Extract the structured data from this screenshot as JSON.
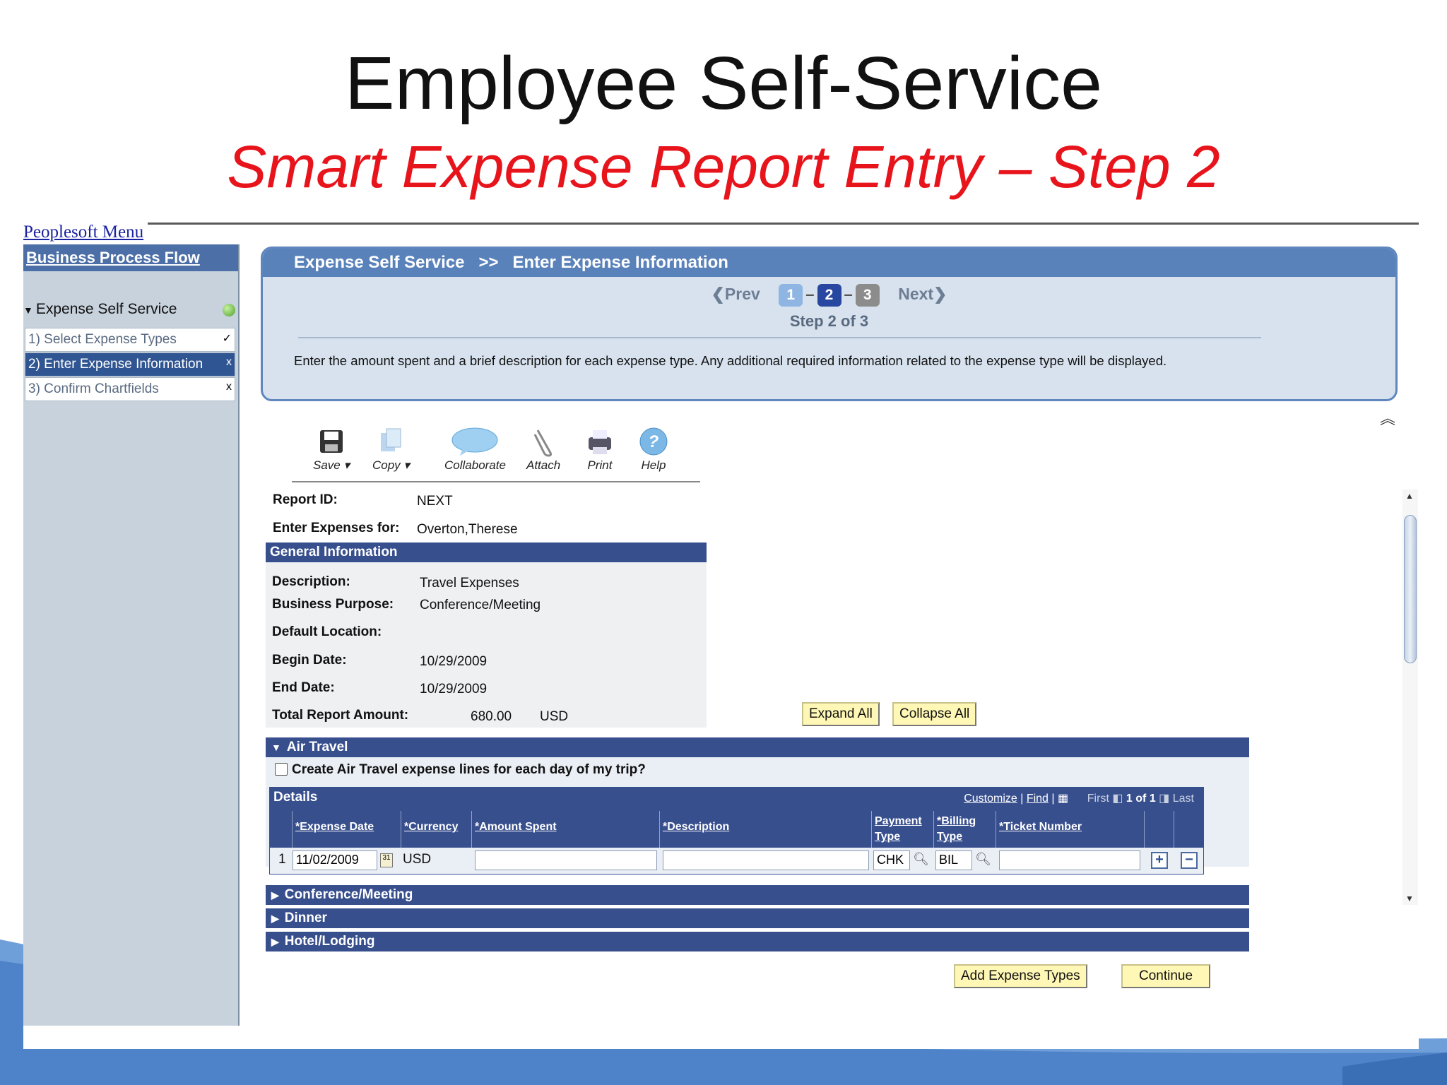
{
  "slide": {
    "title": "Employee Self-Service",
    "subtitle": "Smart Expense Report Entry – Step 2"
  },
  "app": {
    "menu_link": "Peoplesoft Menu"
  },
  "sidebar": {
    "header": "Business Process Flow",
    "group": "Expense Self Service",
    "steps": [
      {
        "label": "1) Select Expense Types",
        "mark": "✓"
      },
      {
        "label": "2) Enter Expense Information",
        "mark": "x"
      },
      {
        "label": "3) Confirm Chartfields",
        "mark": "x"
      }
    ]
  },
  "header": {
    "breadcrumb_1": "Expense Self Service",
    "breadcrumb_sep": ">>",
    "breadcrumb_2": "Enter Expense Information",
    "prev": "Prev",
    "next": "Next",
    "pages": [
      "1",
      "2",
      "3"
    ],
    "step_of": "Step 2 of 3",
    "instructions": "Enter the amount spent and a brief description for each expense type. Any additional required information related to the expense type will be displayed."
  },
  "toolbar": {
    "save": "Save",
    "copy": "Copy",
    "collaborate": "Collaborate",
    "attach": "Attach",
    "print": "Print",
    "help": "Help"
  },
  "report": {
    "report_id_label": "Report ID:",
    "report_id": "NEXT",
    "enter_for_label": "Enter Expenses for:",
    "enter_for": "Overton,Therese",
    "general_info_header": "General Information",
    "description_label": "Description:",
    "description": "Travel Expenses",
    "purpose_label": "Business Purpose:",
    "purpose": "Conference/Meeting",
    "location_label": "Default Location:",
    "begin_label": "Begin Date:",
    "begin": "10/29/2009",
    "end_label": "End Date:",
    "end": "10/29/2009",
    "total_label": "Total Report Amount:",
    "total": "680.00",
    "total_currency": "USD"
  },
  "buttons": {
    "expand_all": "Expand All",
    "collapse_all": "Collapse All",
    "add_expense_types": "Add Expense Types",
    "continue": "Continue"
  },
  "air_travel": {
    "title": "Air Travel",
    "checkbox_label": "Create Air Travel expense lines for each day of my trip?",
    "details_label": "Details",
    "customize": "Customize",
    "find": "Find",
    "first": "First",
    "count": "1 of 1",
    "last": "Last",
    "columns": {
      "expense_date": "*Expense Date",
      "currency": "*Currency",
      "amount": "*Amount Spent",
      "description": "*Description",
      "payment_1": "Payment",
      "payment_2": "Type",
      "billing_1": "*Billing",
      "billing_2": "Type",
      "ticket": "*Ticket Number"
    },
    "row": {
      "num": "1",
      "date": "11/02/2009",
      "currency": "USD",
      "amount": "",
      "description": "",
      "payment": "CHK",
      "billing": "BIL",
      "ticket": ""
    }
  },
  "sections": [
    "Conference/Meeting",
    "Dinner",
    "Hotel/Lodging"
  ],
  "colors": {
    "title": "#111111",
    "subtitle": "#e8141c",
    "section_bar": "#384f8e",
    "header_bar": "#5a82ba",
    "button_bg": "#fff7b5"
  }
}
